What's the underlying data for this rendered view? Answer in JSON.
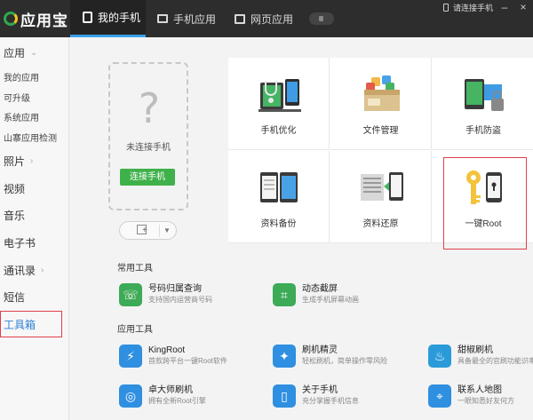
{
  "app": {
    "title": "应用宝"
  },
  "tabs": [
    {
      "label": "我的手机",
      "active": true
    },
    {
      "label": "手机应用",
      "active": false
    },
    {
      "label": "网页应用",
      "active": false
    }
  ],
  "header": {
    "connect_hint": "请连接手机"
  },
  "sidebar": {
    "items": [
      {
        "label": "应用",
        "chevron": "⌄"
      },
      {
        "label": "我的应用"
      },
      {
        "label": "可升级"
      },
      {
        "label": "系统应用"
      },
      {
        "label": "山寨应用检测"
      },
      {
        "label": "照片",
        "chevron": "›"
      },
      {
        "label": "视频"
      },
      {
        "label": "音乐"
      },
      {
        "label": "电子书"
      },
      {
        "label": "通讯录",
        "chevron": "›"
      },
      {
        "label": "短信"
      },
      {
        "label": "工具箱"
      }
    ]
  },
  "device": {
    "placeholder": "?",
    "status": "未连接手机",
    "connect_button": "连接手机"
  },
  "tools_grid": [
    {
      "label": "手机优化",
      "icon": "stethoscope-phone-icon"
    },
    {
      "label": "文件管理",
      "icon": "file-box-icon"
    },
    {
      "label": "手机防盗",
      "icon": "phone-lock-icon"
    },
    {
      "label": "资料备份",
      "icon": "phones-backup-icon"
    },
    {
      "label": "资料还原",
      "icon": "document-restore-icon"
    },
    {
      "label": "一键Root",
      "icon": "key-phone-icon"
    }
  ],
  "common_tools": {
    "title": "常用工具",
    "items": [
      {
        "name": "号码归属查询",
        "desc": "支持国内运营商号码",
        "icon": "phone-query-icon"
      },
      {
        "name": "动态截屏",
        "desc": "生成手机屏幕动画",
        "icon": "screenshot-icon"
      }
    ]
  },
  "app_tools": {
    "title": "应用工具",
    "items": [
      {
        "name": "KingRoot",
        "desc": "首款跨平台一键Root软件",
        "icon": "kingroot-icon"
      },
      {
        "name": "刷机精灵",
        "desc": "轻松刷机，简单操作零风险",
        "icon": "flash-wizard-icon"
      },
      {
        "name": "甜椒刷机",
        "desc": "具备最全的官刷功能识率",
        "icon": "pepper-flash-icon"
      },
      {
        "name": "卓大师刷机",
        "desc": "拥有全新Root引擎",
        "icon": "master-flash-icon"
      },
      {
        "name": "关于手机",
        "desc": "充分掌握手机信息",
        "icon": "about-phone-icon"
      },
      {
        "name": "联系人地图",
        "desc": "一眼知悉好友何方",
        "icon": "contact-map-icon"
      }
    ]
  },
  "colors": {
    "accent": "#3aa0e8",
    "green": "#3fb14a",
    "highlight": "#e0404a"
  }
}
